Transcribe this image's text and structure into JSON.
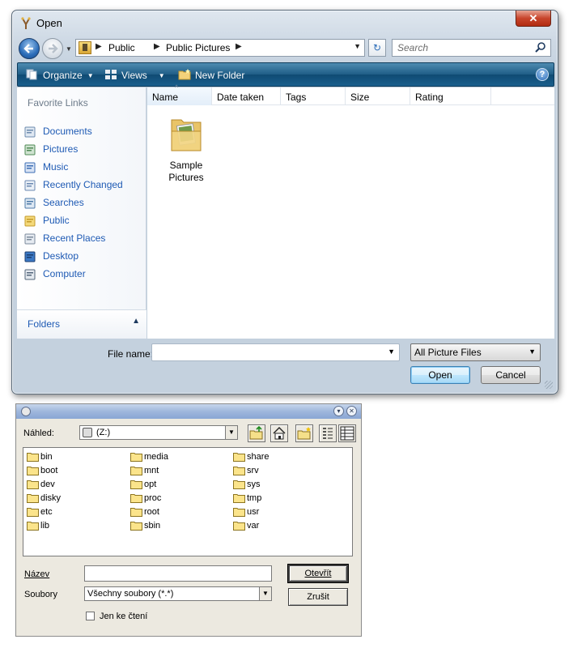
{
  "vista_dialog": {
    "title": "Open",
    "close_glyph": "✕",
    "breadcrumbs": [
      "Public",
      "Public Pictures"
    ],
    "search": {
      "placeholder": "Search"
    },
    "toolbar": {
      "organize": "Organize",
      "views": "Views",
      "new_folder": "New Folder",
      "help": "?"
    },
    "favorite_links_heading": "Favorite Links",
    "favorite_links": [
      {
        "label": "Documents",
        "icon": "documents-icon"
      },
      {
        "label": "Pictures",
        "icon": "pictures-icon"
      },
      {
        "label": "Music",
        "icon": "music-icon"
      },
      {
        "label": "Recently Changed",
        "icon": "recently-changed-icon"
      },
      {
        "label": "Searches",
        "icon": "searches-icon"
      },
      {
        "label": "Public",
        "icon": "public-folder-icon"
      },
      {
        "label": "Recent Places",
        "icon": "recent-places-icon"
      },
      {
        "label": "Desktop",
        "icon": "desktop-icon"
      },
      {
        "label": "Computer",
        "icon": "computer-icon"
      }
    ],
    "folders_label": "Folders",
    "columns": [
      "Name",
      "Date taken",
      "Tags",
      "Size",
      "Rating"
    ],
    "items": [
      {
        "line1": "Sample",
        "line2": "Pictures"
      }
    ],
    "file_name_label": "File name:",
    "file_name_value": "",
    "file_type": "All Picture Files",
    "open_button": "Open",
    "cancel_button": "Cancel",
    "accent_color": "#1e5ab4"
  },
  "classic_dialog": {
    "look_in_label": "Náhled:",
    "look_in_value": "(Z:)",
    "folders": [
      [
        "bin",
        "boot",
        "dev",
        "disky",
        "etc",
        "lib"
      ],
      [
        "media",
        "mnt",
        "opt",
        "proc",
        "root",
        "sbin"
      ],
      [
        "share",
        "srv",
        "sys",
        "tmp",
        "usr",
        "var"
      ]
    ],
    "name_label": "Název",
    "name_value": "",
    "type_label": "Soubory",
    "type_value": "Všechny soubory (*.*)",
    "open_button": "Otevřít",
    "cancel_button": "Zrušit",
    "readonly_label": "Jen ke čtení",
    "readonly_checked": false
  }
}
